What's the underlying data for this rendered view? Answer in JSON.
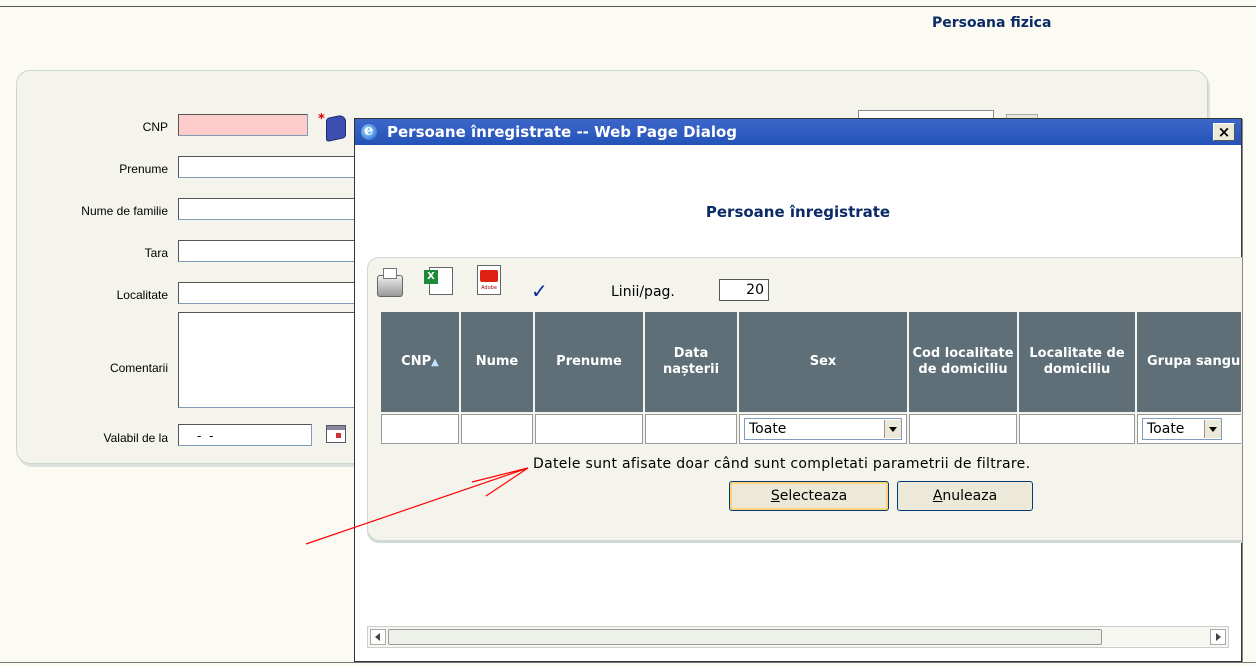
{
  "page": {
    "title": "Persoana fizica"
  },
  "form": {
    "cnp_label": "CNP",
    "cnp_required": "*",
    "prenume_label": "Prenume",
    "nume_label": "Nume de familie",
    "tara_label": "Tara",
    "localitate_label": "Localitate",
    "comentarii_label": "Comentarii",
    "valabil_label": "Valabil de la",
    "valabil_value": "-  -"
  },
  "dialog": {
    "window_title": "Persoane înregistrate -- Web Page Dialog",
    "close_label": "×",
    "heading": "Persoane înregistrate",
    "lines_label": "Linii/pag.",
    "lines_value": "20",
    "columns": [
      {
        "label": "CNP",
        "sort": "▲"
      },
      {
        "label": "Nume"
      },
      {
        "label": "Prenume"
      },
      {
        "label": "Data nașterii"
      },
      {
        "label": "Sex"
      },
      {
        "label": "Cod localitate de domiciliu"
      },
      {
        "label": "Localitate de domiciliu"
      },
      {
        "label": "Grupa sanguină"
      }
    ],
    "filters": {
      "sex": "Toate",
      "grupa": "Toate"
    },
    "message": "Datele sunt afisate doar când sunt completati parametrii de filtrare.",
    "select_button": {
      "accel": "S",
      "rest": "electeaza"
    },
    "cancel_button": {
      "accel": "A",
      "rest": "nuleaza"
    }
  },
  "colors": {
    "accent": "#0b2a66",
    "required_field": "#ffcccc",
    "header_bg": "#5e6f78",
    "annotation": "#ff0000"
  }
}
